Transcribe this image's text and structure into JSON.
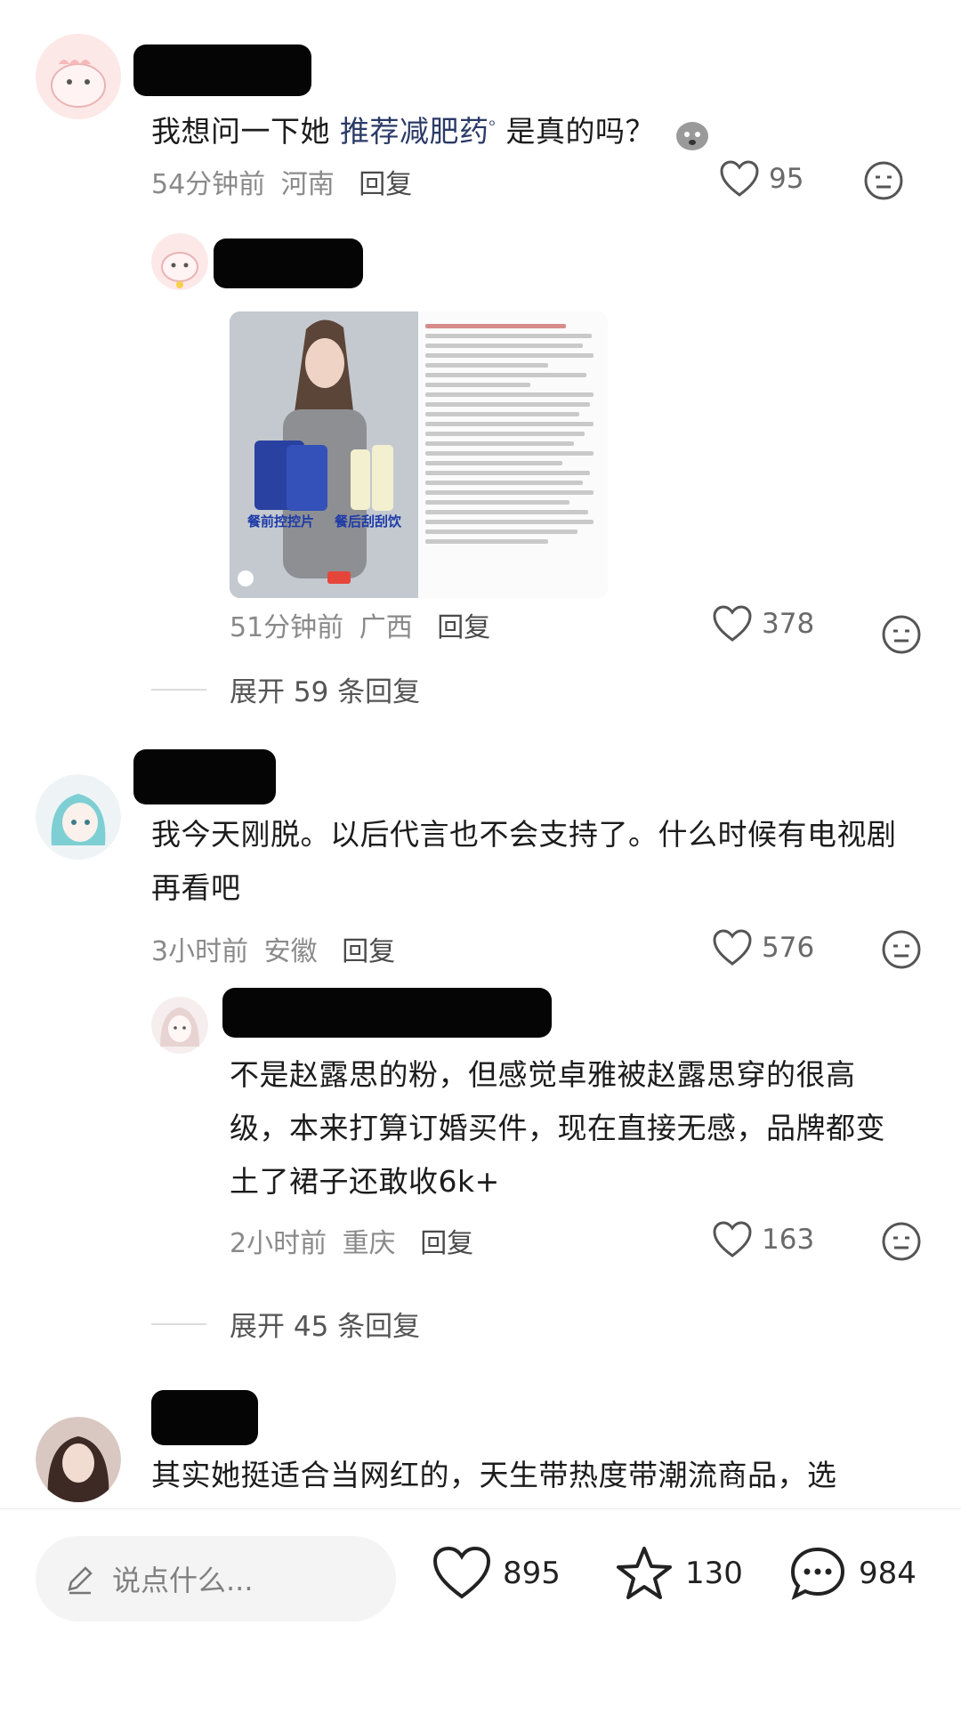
{
  "comments": [
    {
      "text_prefix": "我想问一下她 ",
      "link_text": "推荐减肥药",
      "text_suffix": " 是真的吗？",
      "time": "54分钟前",
      "location": "河南",
      "reply_label": "回复",
      "likes": "95"
    },
    {
      "time": "51分钟前",
      "location": "广西",
      "reply_label": "回复",
      "likes": "378",
      "image_captions": [
        "餐前控控片",
        "餐后刮刮饮"
      ],
      "expand_label": "展开 59 条回复"
    },
    {
      "text": "我今天刚脱。以后代言也不会支持了。什么时候有电视剧再看吧",
      "time": "3小时前",
      "location": "安徽",
      "reply_label": "回复",
      "likes": "576"
    },
    {
      "text": "不是赵露思的粉，但感觉卓雅被赵露思穿的很高级，本来打算订婚买件，现在直接无感，品牌都变土了裙子还敢收6k+",
      "time": "2小时前",
      "location": "重庆",
      "reply_label": "回复",
      "likes": "163",
      "expand_label": "展开 45 条回复"
    },
    {
      "text": "其实她挺适合当网红的，天生带热度带潮流商品，选"
    }
  ],
  "bottom_bar": {
    "input_placeholder": "说点什么...",
    "likes": "895",
    "favorites": "130",
    "comments": "984"
  },
  "colors": {
    "link": "#2b3a67",
    "meta": "#8a8a8a"
  }
}
